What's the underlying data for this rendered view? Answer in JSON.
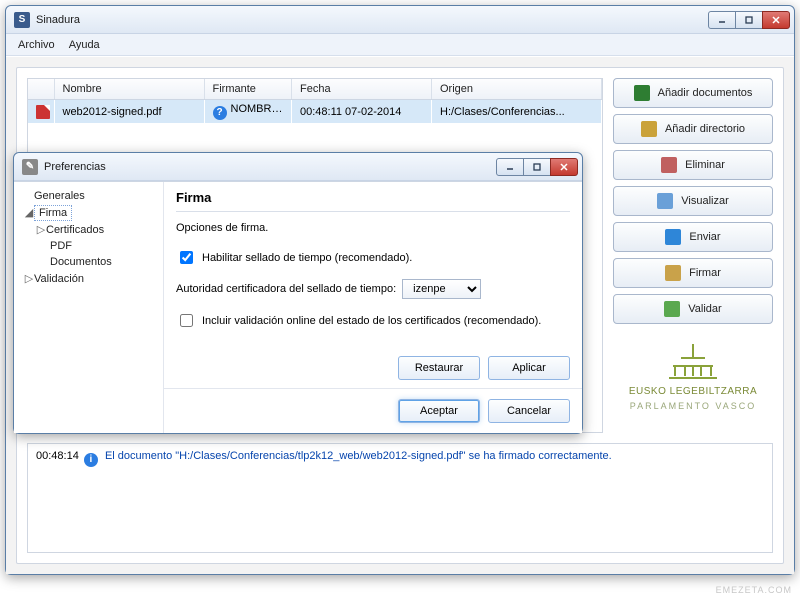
{
  "app": {
    "title": "Sinadura",
    "iconLetter": "S"
  },
  "menu": {
    "archivo": "Archivo",
    "ayuda": "Ayuda"
  },
  "table": {
    "headers": {
      "blank": "",
      "nombre": "Nombre",
      "firmante": "Firmante",
      "fecha": "Fecha",
      "origen": "Origen"
    },
    "rows": [
      {
        "nombre": "web2012-signed.pdf",
        "firmante": "NOMBRE HERNANDEZ ...",
        "fecha": "00:48:11 07-02-2014",
        "origen": "H:/Clases/Conferencias..."
      }
    ]
  },
  "buttons": {
    "addDoc": "Añadir documentos",
    "addDir": "Añadir directorio",
    "delete": "Eliminar",
    "view": "Visualizar",
    "send": "Enviar",
    "sign": "Firmar",
    "validate": "Validar"
  },
  "logo": {
    "line1": "EUSKO LEGEBILTZARRA",
    "line2": "PARLAMENTO VASCO"
  },
  "log": {
    "time": "00:48:14",
    "message": "El documento \"H:/Clases/Conferencias/tlp2k12_web/web2012-signed.pdf\" se ha firmado correctamente."
  },
  "brand": "EMEZETA.COM",
  "prefs": {
    "title": "Preferencias",
    "tree": {
      "generales": "Generales",
      "firma": "Firma",
      "certificados": "Certificados",
      "pdf": "PDF",
      "documentos": "Documentos",
      "validacion": "Validación"
    },
    "pane": {
      "heading": "Firma",
      "desc": "Opciones de firma.",
      "enableTimestamp": "Habilitar sellado de tiempo (recomendado).",
      "tsAuthorityLabel": "Autoridad certificadora del sellado de tiempo:",
      "tsAuthorityValue": "izenpe",
      "onlineValidation": "Incluir validación online del estado de los certificados (recomendado).",
      "restore": "Restaurar",
      "apply": "Aplicar",
      "ok": "Aceptar",
      "cancel": "Cancelar"
    },
    "checks": {
      "enableTimestamp": true,
      "onlineValidation": false
    }
  },
  "iconColors": {
    "addDoc": "#2e7d32",
    "addDir": "#caa23a",
    "delete": "#c06060",
    "view": "#6aa0d8",
    "send": "#2e86d8",
    "sign": "#c9a24a",
    "validate": "#5aa84f"
  }
}
